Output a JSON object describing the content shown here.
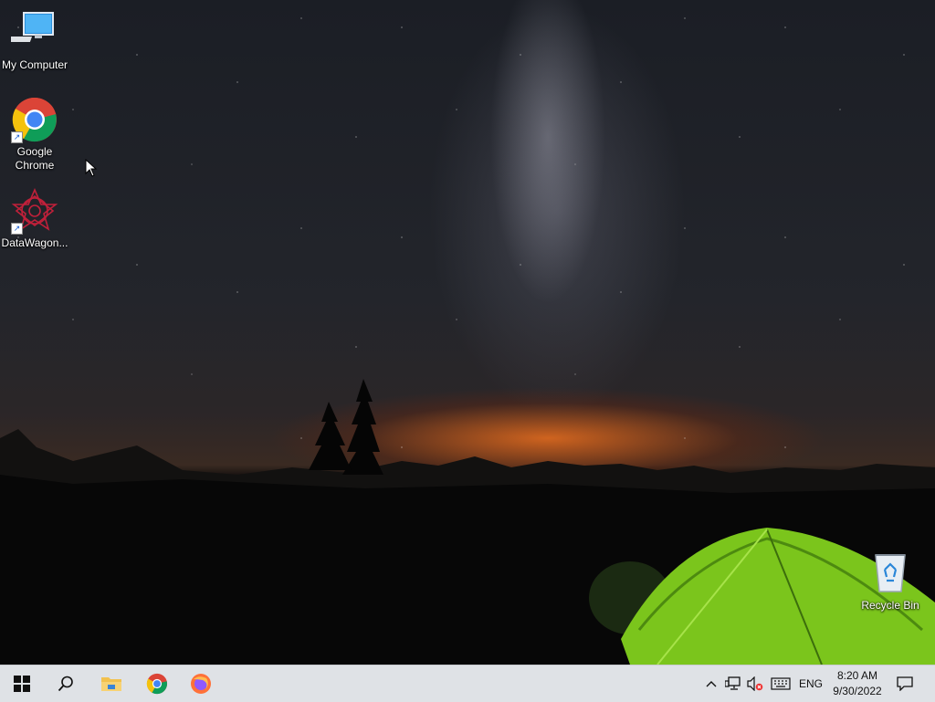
{
  "desktop": {
    "icons": [
      {
        "label": "My Computer",
        "icon": "computer-icon"
      },
      {
        "label_line1": "Google",
        "label_line2": "Chrome",
        "icon": "chrome-icon"
      },
      {
        "label": "DataWagon...",
        "icon": "datawagon-icon"
      },
      {
        "label": "Recycle Bin",
        "icon": "recycle-bin-icon"
      }
    ]
  },
  "taskbar": {
    "pinned": [
      {
        "icon": "windows-start-icon"
      },
      {
        "icon": "search-icon"
      },
      {
        "icon": "file-explorer-icon"
      },
      {
        "icon": "chrome-icon"
      },
      {
        "icon": "firefox-icon"
      }
    ],
    "tray": {
      "icons": [
        "chevron-up-icon",
        "network-icon",
        "volume-muted-icon",
        "keyboard-icon"
      ],
      "language": "ENG",
      "time": "8:20 AM",
      "date": "9/30/2022",
      "notification_icon": "notification-icon"
    }
  },
  "colors": {
    "taskbar_bg": "#dfe2e6",
    "desktop_text": "#ffffff"
  }
}
